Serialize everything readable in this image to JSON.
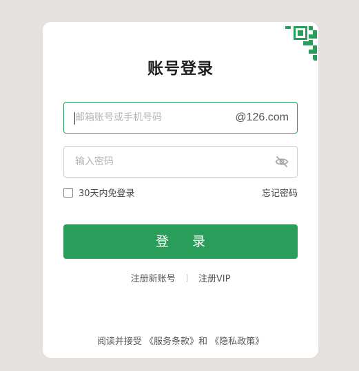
{
  "login": {
    "title": "账号登录",
    "email_placeholder": "邮箱账号或手机号码",
    "email_domain": "@126.com",
    "password_placeholder": "输入密码",
    "remember_label": "30天内免登录",
    "forgot_label": "忘记密码",
    "submit_label": "登 录",
    "register_label": "注册新账号",
    "vip_label": "注册VIP",
    "agreement": {
      "prefix": "阅读并接受",
      "terms": "《服务条款》",
      "conjunction": "和",
      "privacy": "《隐私政策》"
    }
  },
  "colors": {
    "accent": "#2a9d5a",
    "background": "#e4e1de"
  },
  "icons": {
    "qr": "qr-code-icon",
    "eye": "eye-hidden-icon"
  }
}
